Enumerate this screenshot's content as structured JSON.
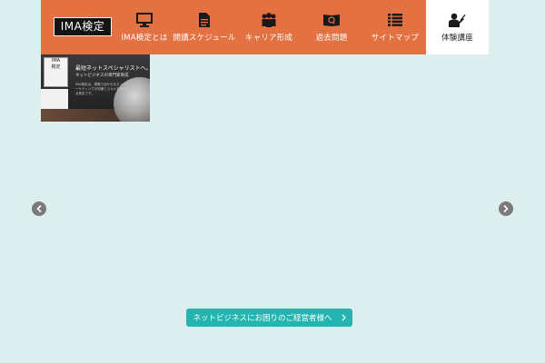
{
  "header": {
    "logo": "IMA検定",
    "nav": [
      {
        "label": "IMA検定とは",
        "icon": "monitor-icon"
      },
      {
        "label": "開講スケジュール",
        "icon": "document-icon"
      },
      {
        "label": "キャリア形成",
        "icon": "people-icon"
      },
      {
        "label": "過去問題",
        "icon": "book-search-icon"
      },
      {
        "label": "サイトマップ",
        "icon": "list-icon"
      },
      {
        "label": "体験講座",
        "icon": "teacher-icon"
      }
    ],
    "active_index": 5
  },
  "slide": {
    "logo_line1": "IMA",
    "logo_line2": "検定",
    "headline": "最短ネットスペシャリストへ。",
    "subline": "ネットビジネスの専門家育成",
    "body": "IMA検定は、現場で活かせるネットマーケティングの知識とスキルを習得する検定です。"
  },
  "carousel": {
    "prev_icon": "chevron-left-icon",
    "next_icon": "chevron-right-icon"
  },
  "cta": {
    "label": "ネットビジネスにお困りのご経営者様へ",
    "icon": "chevron-right-icon"
  },
  "colors": {
    "header": "#e37142",
    "background": "#dcefee",
    "cta": "#24b5b0"
  }
}
